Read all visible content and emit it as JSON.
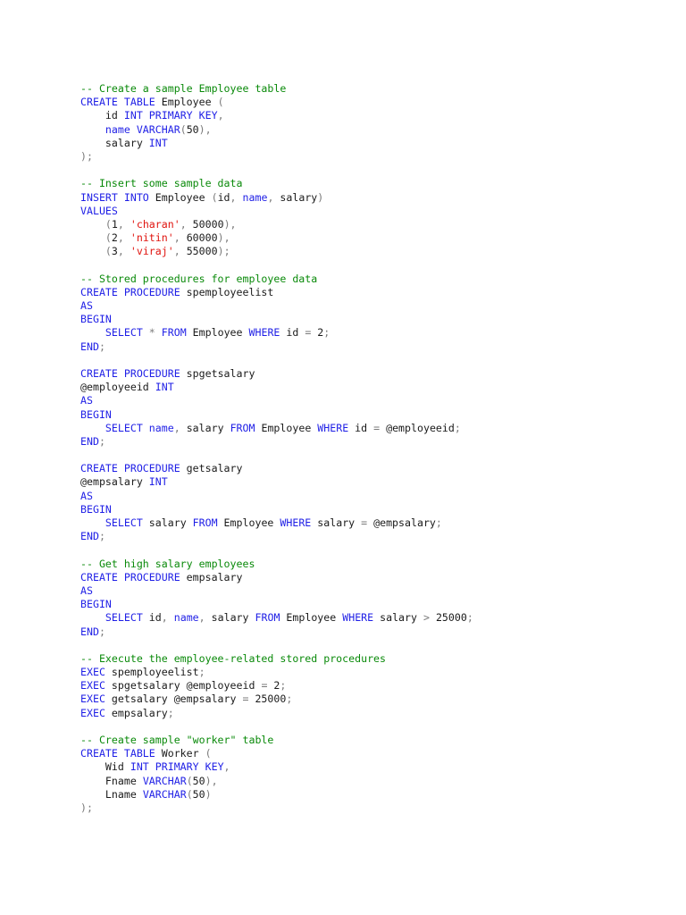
{
  "colors": {
    "keyword": "#1f1fe6",
    "string": "#e0140f",
    "comment": "#0a8a0a",
    "operator": "#7a7a7a",
    "text": "#1a1a1a"
  },
  "code_lines": [
    [
      [
        "cm",
        "-- Create a sample Employee table"
      ]
    ],
    [
      [
        "kw",
        "CREATE TABLE"
      ],
      [
        "tx",
        " Employee "
      ],
      [
        "op",
        "("
      ]
    ],
    [
      [
        "tx",
        "    id "
      ],
      [
        "kw",
        "INT PRIMARY KEY"
      ],
      [
        "op",
        ","
      ]
    ],
    [
      [
        "kw",
        "    name"
      ],
      [
        "tx",
        " "
      ],
      [
        "kw",
        "VARCHAR"
      ],
      [
        "op",
        "("
      ],
      [
        "tx",
        "50"
      ],
      [
        "op",
        "),"
      ]
    ],
    [
      [
        "tx",
        "    salary "
      ],
      [
        "kw",
        "INT"
      ]
    ],
    [
      [
        "op",
        ");"
      ]
    ],
    [],
    [
      [
        "cm",
        "-- Insert some sample data"
      ]
    ],
    [
      [
        "kw",
        "INSERT INTO"
      ],
      [
        "tx",
        " Employee "
      ],
      [
        "op",
        "("
      ],
      [
        "tx",
        "id"
      ],
      [
        "op",
        ", "
      ],
      [
        "kw",
        "name"
      ],
      [
        "op",
        ", "
      ],
      [
        "tx",
        "salary"
      ],
      [
        "op",
        ")"
      ]
    ],
    [
      [
        "kw",
        "VALUES"
      ]
    ],
    [
      [
        "op",
        "    ("
      ],
      [
        "tx",
        "1"
      ],
      [
        "op",
        ", "
      ],
      [
        "str",
        "'charan'"
      ],
      [
        "op",
        ", "
      ],
      [
        "tx",
        "50000"
      ],
      [
        "op",
        "),"
      ]
    ],
    [
      [
        "op",
        "    ("
      ],
      [
        "tx",
        "2"
      ],
      [
        "op",
        ", "
      ],
      [
        "str",
        "'nitin'"
      ],
      [
        "op",
        ", "
      ],
      [
        "tx",
        "60000"
      ],
      [
        "op",
        "),"
      ]
    ],
    [
      [
        "op",
        "    ("
      ],
      [
        "tx",
        "3"
      ],
      [
        "op",
        ", "
      ],
      [
        "str",
        "'viraj'"
      ],
      [
        "op",
        ", "
      ],
      [
        "tx",
        "55000"
      ],
      [
        "op",
        ");"
      ]
    ],
    [],
    [
      [
        "cm",
        "-- Stored procedures for employee data"
      ]
    ],
    [
      [
        "kw",
        "CREATE PROCEDURE"
      ],
      [
        "tx",
        " spemployeelist"
      ]
    ],
    [
      [
        "kw",
        "AS"
      ]
    ],
    [
      [
        "kw",
        "BEGIN"
      ]
    ],
    [
      [
        "kw",
        "    SELECT"
      ],
      [
        "op",
        " * "
      ],
      [
        "kw",
        "FROM"
      ],
      [
        "tx",
        " Employee "
      ],
      [
        "kw",
        "WHERE"
      ],
      [
        "tx",
        " id "
      ],
      [
        "op",
        "= "
      ],
      [
        "tx",
        "2"
      ],
      [
        "op",
        ";"
      ]
    ],
    [
      [
        "kw",
        "END"
      ],
      [
        "op",
        ";"
      ]
    ],
    [],
    [
      [
        "kw",
        "CREATE PROCEDURE"
      ],
      [
        "tx",
        " spgetsalary"
      ]
    ],
    [
      [
        "tx",
        "@employeeid "
      ],
      [
        "kw",
        "INT"
      ]
    ],
    [
      [
        "kw",
        "AS"
      ]
    ],
    [
      [
        "kw",
        "BEGIN"
      ]
    ],
    [
      [
        "kw",
        "    SELECT"
      ],
      [
        "tx",
        " "
      ],
      [
        "kw",
        "name"
      ],
      [
        "op",
        ", "
      ],
      [
        "tx",
        "salary "
      ],
      [
        "kw",
        "FROM"
      ],
      [
        "tx",
        " Employee "
      ],
      [
        "kw",
        "WHERE"
      ],
      [
        "tx",
        " id "
      ],
      [
        "op",
        "= "
      ],
      [
        "tx",
        "@employeeid"
      ],
      [
        "op",
        ";"
      ]
    ],
    [
      [
        "kw",
        "END"
      ],
      [
        "op",
        ";"
      ]
    ],
    [],
    [
      [
        "kw",
        "CREATE PROCEDURE"
      ],
      [
        "tx",
        " getsalary"
      ]
    ],
    [
      [
        "tx",
        "@empsalary "
      ],
      [
        "kw",
        "INT"
      ]
    ],
    [
      [
        "kw",
        "AS"
      ]
    ],
    [
      [
        "kw",
        "BEGIN"
      ]
    ],
    [
      [
        "kw",
        "    SELECT"
      ],
      [
        "tx",
        " salary "
      ],
      [
        "kw",
        "FROM"
      ],
      [
        "tx",
        " Employee "
      ],
      [
        "kw",
        "WHERE"
      ],
      [
        "tx",
        " salary "
      ],
      [
        "op",
        "= "
      ],
      [
        "tx",
        "@empsalary"
      ],
      [
        "op",
        ";"
      ]
    ],
    [
      [
        "kw",
        "END"
      ],
      [
        "op",
        ";"
      ]
    ],
    [],
    [
      [
        "cm",
        "-- Get high salary employees"
      ]
    ],
    [
      [
        "kw",
        "CREATE PROCEDURE"
      ],
      [
        "tx",
        " empsalary"
      ]
    ],
    [
      [
        "kw",
        "AS"
      ]
    ],
    [
      [
        "kw",
        "BEGIN"
      ]
    ],
    [
      [
        "kw",
        "    SELECT"
      ],
      [
        "tx",
        " id"
      ],
      [
        "op",
        ", "
      ],
      [
        "kw",
        "name"
      ],
      [
        "op",
        ", "
      ],
      [
        "tx",
        "salary "
      ],
      [
        "kw",
        "FROM"
      ],
      [
        "tx",
        " Employee "
      ],
      [
        "kw",
        "WHERE"
      ],
      [
        "tx",
        " salary "
      ],
      [
        "op",
        "> "
      ],
      [
        "tx",
        "25000"
      ],
      [
        "op",
        ";"
      ]
    ],
    [
      [
        "kw",
        "END"
      ],
      [
        "op",
        ";"
      ]
    ],
    [],
    [
      [
        "cm",
        "-- Execute the employee-related stored procedures"
      ]
    ],
    [
      [
        "kw",
        "EXEC"
      ],
      [
        "tx",
        " spemployeelist"
      ],
      [
        "op",
        ";"
      ]
    ],
    [
      [
        "kw",
        "EXEC"
      ],
      [
        "tx",
        " spgetsalary @employeeid "
      ],
      [
        "op",
        "= "
      ],
      [
        "tx",
        "2"
      ],
      [
        "op",
        ";"
      ]
    ],
    [
      [
        "kw",
        "EXEC"
      ],
      [
        "tx",
        " getsalary @empsalary "
      ],
      [
        "op",
        "= "
      ],
      [
        "tx",
        "25000"
      ],
      [
        "op",
        ";"
      ]
    ],
    [
      [
        "kw",
        "EXEC"
      ],
      [
        "tx",
        " empsalary"
      ],
      [
        "op",
        ";"
      ]
    ],
    [],
    [
      [
        "cm",
        "-- Create sample \"worker\" table"
      ]
    ],
    [
      [
        "kw",
        "CREATE TABLE"
      ],
      [
        "tx",
        " Worker "
      ],
      [
        "op",
        "("
      ]
    ],
    [
      [
        "tx",
        "    Wid "
      ],
      [
        "kw",
        "INT PRIMARY KEY"
      ],
      [
        "op",
        ","
      ]
    ],
    [
      [
        "tx",
        "    Fname "
      ],
      [
        "kw",
        "VARCHAR"
      ],
      [
        "op",
        "("
      ],
      [
        "tx",
        "50"
      ],
      [
        "op",
        "),"
      ]
    ],
    [
      [
        "tx",
        "    Lname "
      ],
      [
        "kw",
        "VARCHAR"
      ],
      [
        "op",
        "("
      ],
      [
        "tx",
        "50"
      ],
      [
        "op",
        ")"
      ]
    ],
    [
      [
        "op",
        ");"
      ]
    ]
  ]
}
